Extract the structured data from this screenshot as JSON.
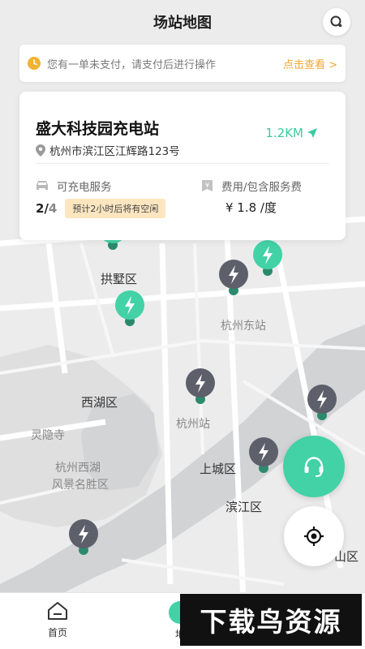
{
  "header": {
    "title": "场站地图"
  },
  "notice": {
    "message": "您有一单未支付，请支付后进行操作",
    "link": "点击查看 >"
  },
  "station": {
    "name": "盛大科技园充电站",
    "distance": "1.2KM",
    "address": "杭州市滨江区江辉路123号",
    "available_label": "可充电服务",
    "available_count": "2",
    "separator": "/",
    "total_count": "4",
    "forecast_badge": "预计2小时后将有空闲",
    "fee_label": "费用/包含服务费",
    "price": "¥ 1.8 /度"
  },
  "map": {
    "labels": {
      "gongshu": "拱墅区",
      "hangzhou_east": "杭州东站",
      "xihu": "西湖区",
      "lingyin": "灵隐寺",
      "hangzhou_station": "杭州站",
      "xihu_scenic_1": "杭州西湖",
      "xihu_scenic_2": "风景名胜区",
      "shangcheng": "上城区",
      "binjiang": "滨江区",
      "partial_edge": "山区"
    },
    "colors": {
      "green_pin": "#42d2a5",
      "gray_pin": "#5d5f6b",
      "accent": "#3dc9a0"
    }
  },
  "tabbar": {
    "home_label": "首页",
    "map_label_partial": "地"
  },
  "watermark": {
    "text": "下载鸟资源"
  }
}
